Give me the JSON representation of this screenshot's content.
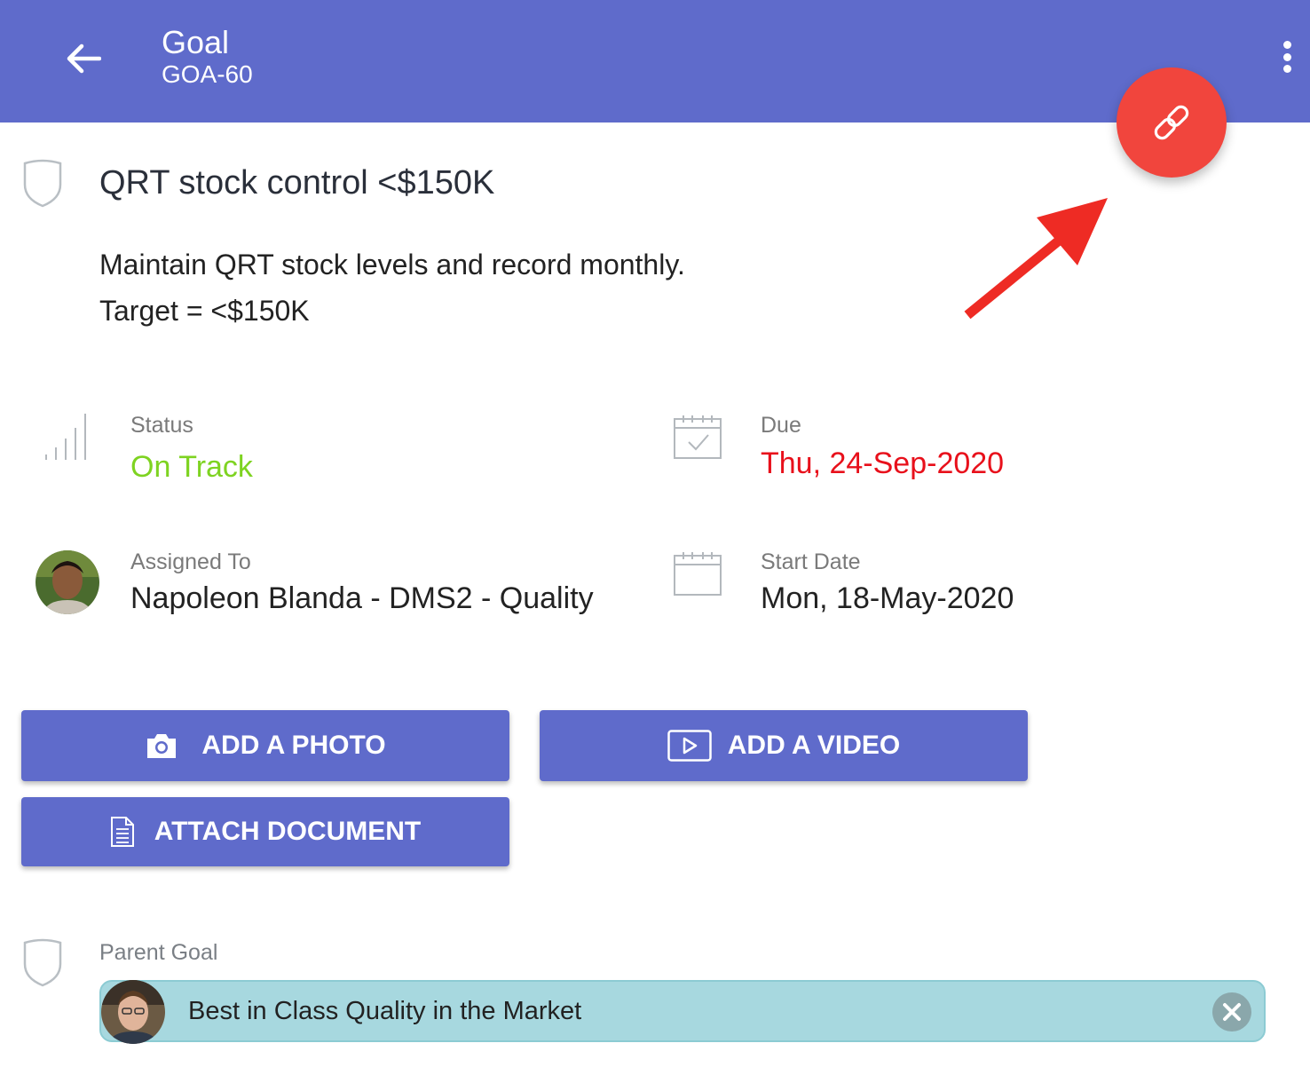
{
  "header": {
    "title": "Goal",
    "subtitle": "GOA-60"
  },
  "icons": {
    "back": "arrow-left-icon",
    "more": "more-vert-icon",
    "fab": "link-icon",
    "goal": "shield-icon",
    "status": "signal-bars-icon",
    "due": "calendar-check-icon",
    "start": "calendar-icon",
    "photo": "camera-icon",
    "video": "video-play-icon",
    "document": "document-icon",
    "remove": "close-circle-icon"
  },
  "colors": {
    "brand": "#5f6bcb",
    "fab": "#f1453d",
    "status_on_track": "#7ed321",
    "due_overdue": "#e8101b",
    "chip": "#a7d8df",
    "annotation_arrow": "#ee2b24"
  },
  "goal": {
    "title": "QRT stock control <$150K",
    "description_line1": "Maintain QRT stock levels and record monthly.",
    "description_line2": "Target = <$150K"
  },
  "fields": {
    "status_label": "Status",
    "status_value": "On Track",
    "due_label": "Due",
    "due_value": "Thu, 24-Sep-2020",
    "assigned_label": "Assigned To",
    "assigned_value": "Napoleon Blanda - DMS2 - Quality",
    "start_label": "Start Date",
    "start_value": "Mon, 18-May-2020"
  },
  "actions": {
    "add_photo": "ADD A PHOTO",
    "add_video": "ADD A VIDEO",
    "attach_document": "ATTACH DOCUMENT"
  },
  "parent": {
    "label": "Parent Goal",
    "goal_name": "Best in Class Quality in the Market"
  }
}
